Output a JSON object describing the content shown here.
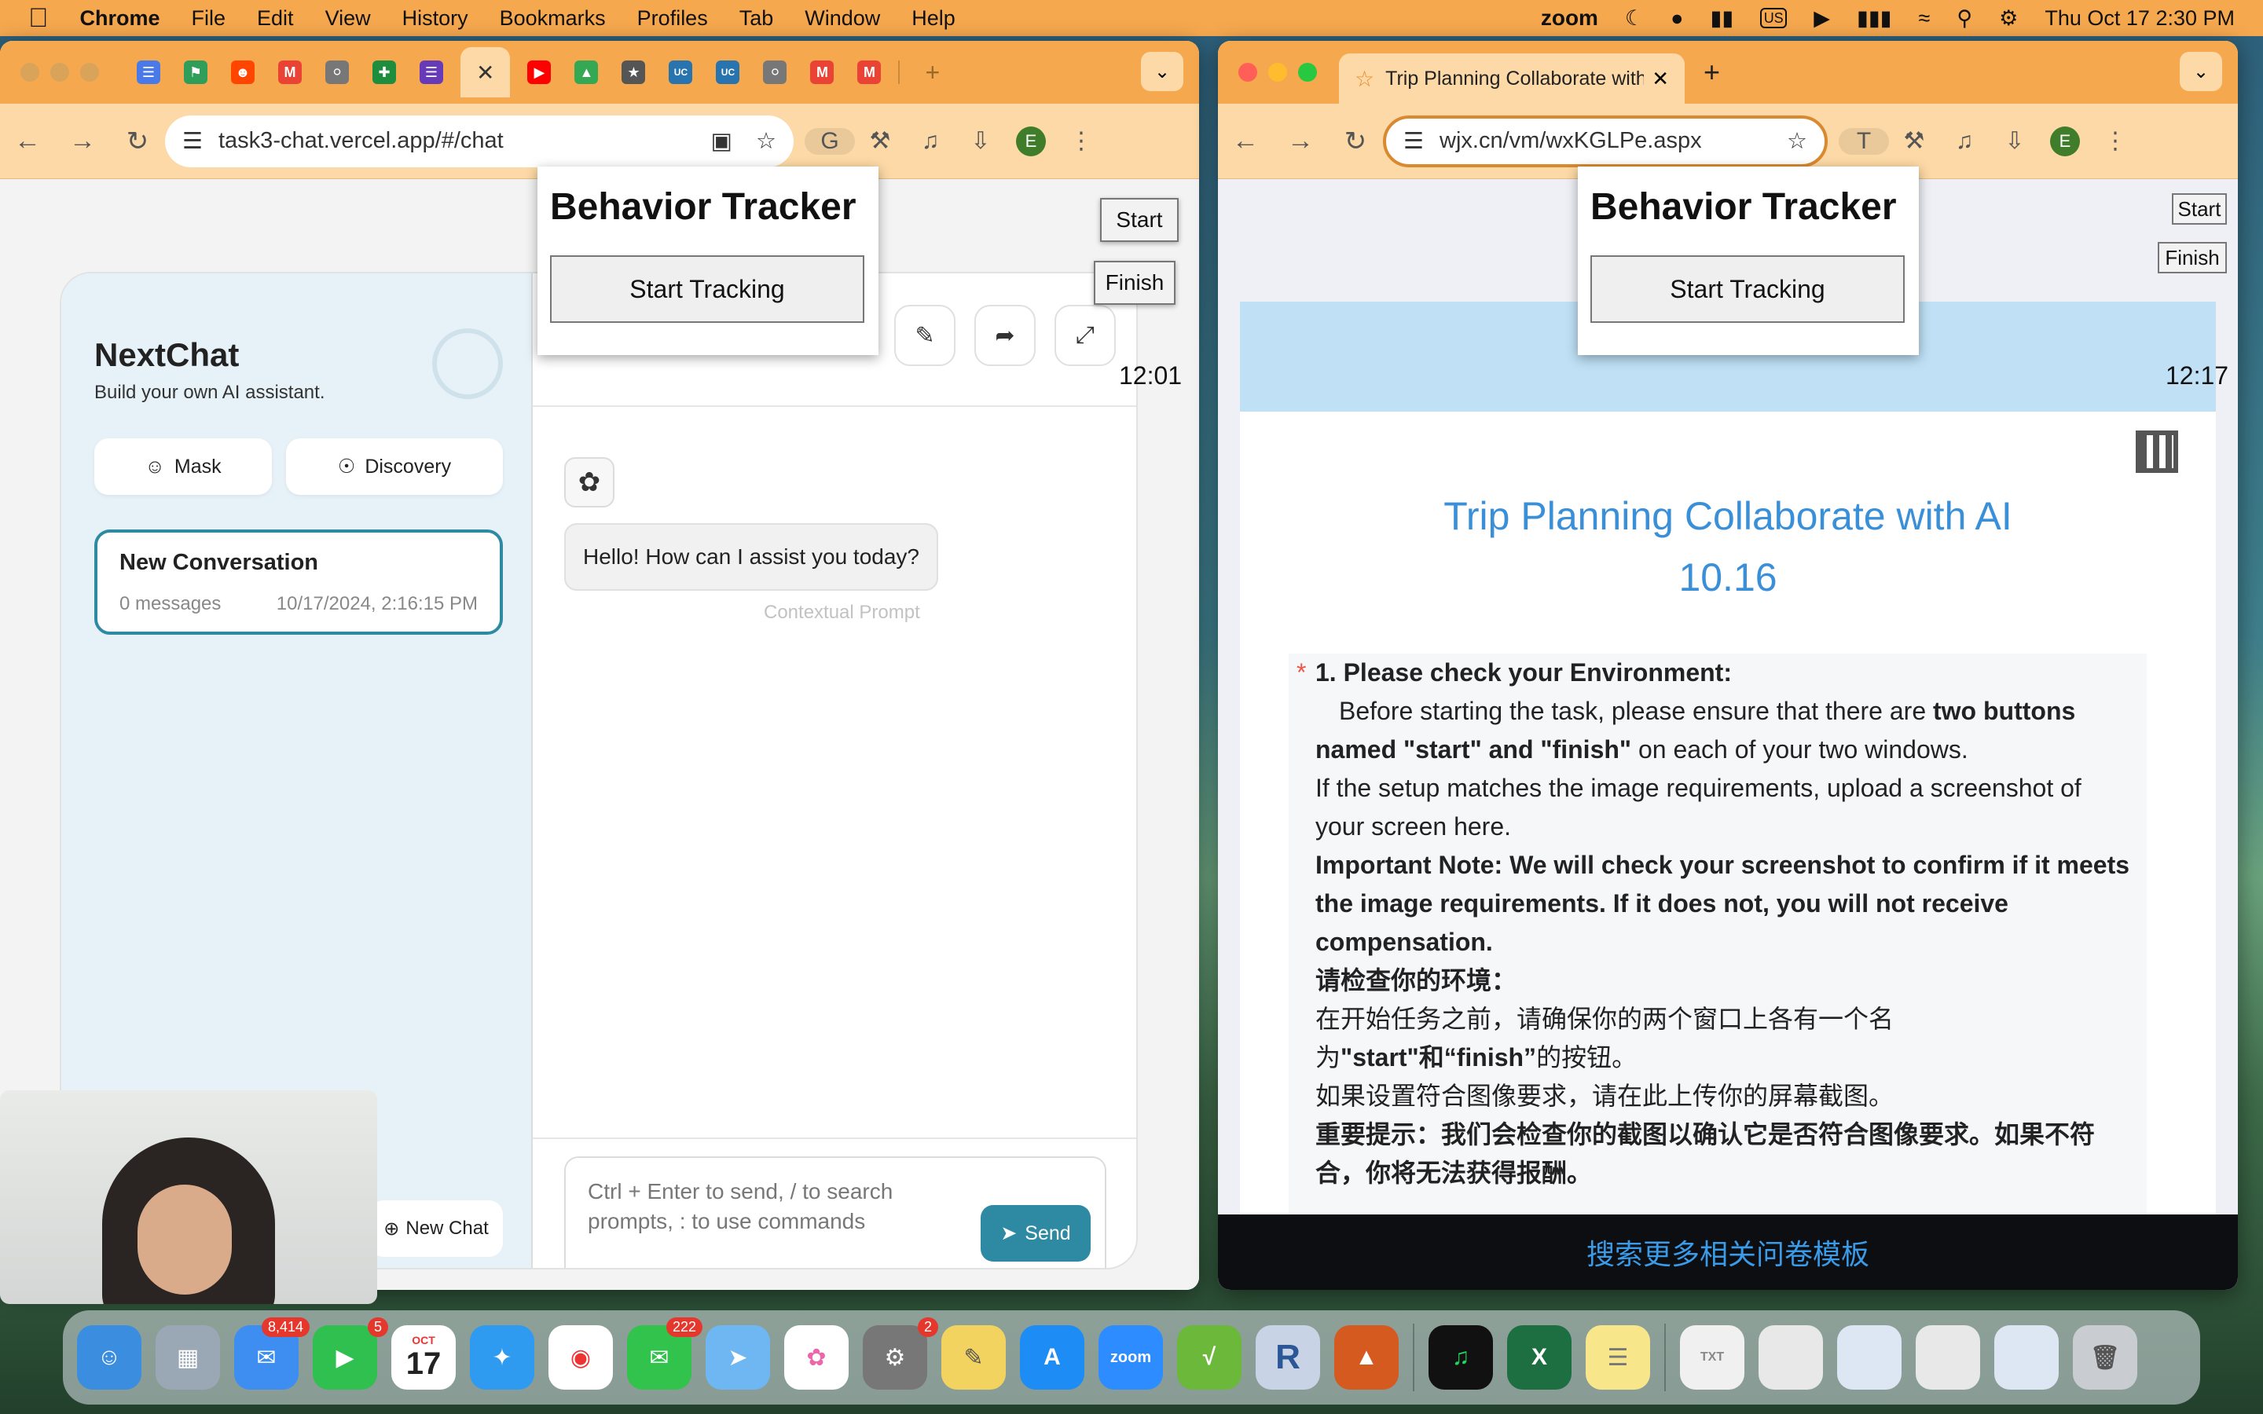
{
  "menubar": {
    "app": "Chrome",
    "items": [
      "File",
      "Edit",
      "View",
      "History",
      "Bookmarks",
      "Profiles",
      "Tab",
      "Window",
      "Help"
    ],
    "zoom_label": "zoom",
    "us_label": "US",
    "datetime": "Thu Oct 17  2:30 PM"
  },
  "left_window": {
    "url": "task3-chat.vercel.app/#/chat",
    "avatar": "E",
    "nextchat": {
      "brand": "NextChat",
      "subtitle": "Build your own AI assistant.",
      "mask_button": "Mask",
      "discovery_button": "Discovery",
      "conversation": {
        "title": "New Conversation",
        "count": "0 messages",
        "date": "10/17/2024, 2:16:15 PM"
      },
      "new_chat_button": "New Chat",
      "message": "Hello! How can I assist you today?",
      "context_label": "Contextual Prompt",
      "input_placeholder": "Ctrl + Enter to send, / to search prompts, : to use commands",
      "send_button": "Send",
      "time": "12:01"
    },
    "tracker": {
      "title": "Behavior Tracker",
      "start_tracking": "Start Tracking",
      "start": "Start",
      "finish": "Finish"
    }
  },
  "right_window": {
    "tab_title": "Trip Planning Collaborate with",
    "url": "wjx.cn/vm/wxKGLPe.aspx",
    "avatar": "E",
    "profile_letter": "T",
    "tracker": {
      "title": "Behavior Tracker",
      "start_tracking": "Start Tracking",
      "start": "Start",
      "finish": "Finish"
    },
    "time": "12:17",
    "survey": {
      "title_line1": "Trip Planning Collaborate with AI",
      "title_line2": "10.16",
      "q_heading": "1. Please check your Environment:",
      "p1_a": "Before starting the task, please ensure that there are ",
      "p1_b": "two buttons named \"start\" and \"finish\"",
      "p1_c": " on each of your two windows.",
      "p2": "If the setup matches the image requirements, upload a screenshot of your screen here.",
      "p3": "Important Note: We will check your screenshot to confirm if it meets the image requirements. If it does not, you will not receive compensation.",
      "cn1": "请检查你的环境：",
      "cn2": "在开始任务之前，请确保你的两个窗口上各有一个名",
      "cn3_a": "为",
      "cn3_b": "\"start\"和“finish”",
      "cn3_c": "的按钮。",
      "cn4": "如果设置符合图像要求，请在此上传你的屏幕截图。",
      "cn5": "重要提示：我们会检查你的截图以确认它是否符合图像要求。如果不符合，你将无法获得报酬。",
      "footer": "搜索更多相关问卷模板"
    }
  },
  "dock": {
    "mail_badge": "8,414",
    "facetime_badge": "5",
    "calendar_month": "OCT",
    "calendar_day": "17",
    "messages_badge": "222",
    "settings_badge": "2",
    "zoom_label": "zoom",
    "r_label": "R"
  },
  "colors": {
    "menubar": "#f6a84f",
    "accent": "#2e8aa3",
    "survey_title": "#3a8fd9"
  }
}
